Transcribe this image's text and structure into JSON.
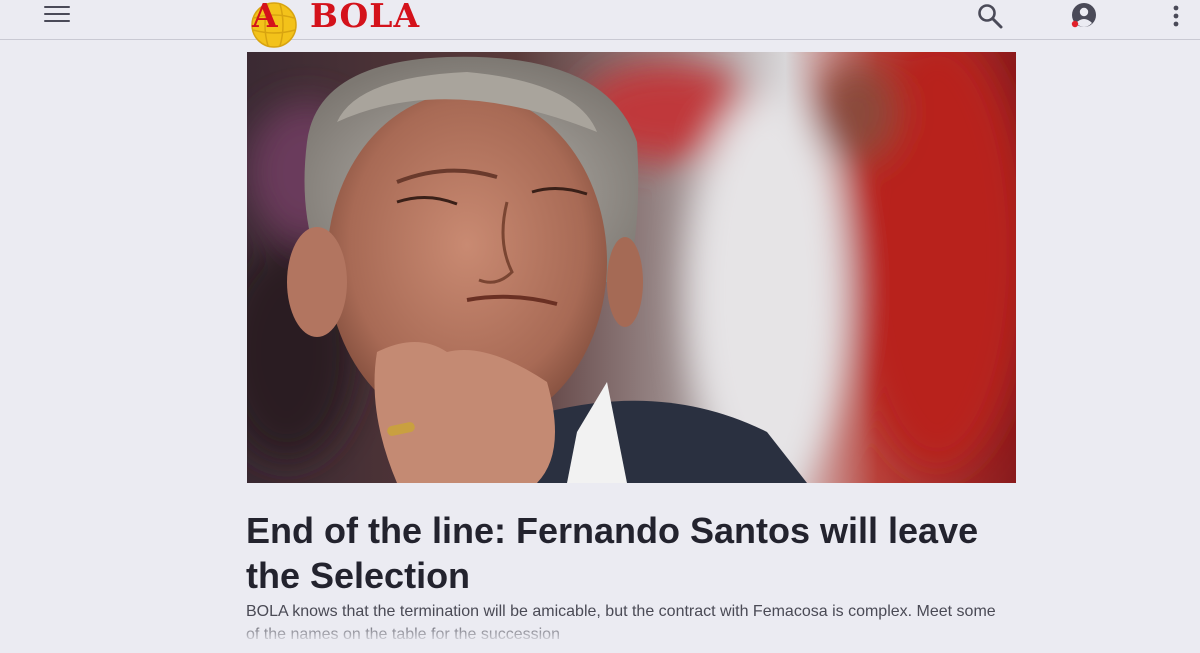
{
  "header": {
    "logo_text": "BOLA",
    "logo_letter": "A",
    "icons": {
      "menu": "hamburger-menu-icon",
      "search": "search-icon",
      "user": "user-account-icon",
      "more": "more-vertical-icon"
    },
    "colors": {
      "brand_red": "#d4121b",
      "logo_ball": "#f3c21a",
      "icon": "#4a4a58",
      "notification_dot": "#e0202a"
    }
  },
  "article": {
    "headline": "End of the line: Fernando Santos will leave the Selection",
    "lead": "BOLA knows that the termination will be amicable, but the contract with Femacosa is complex. Meet some of the names on the table for the succession"
  }
}
